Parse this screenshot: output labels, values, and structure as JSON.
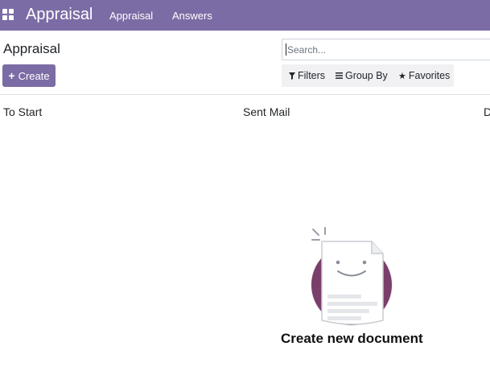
{
  "navbar": {
    "app_title": "Appraisal",
    "menu": [
      "Appraisal",
      "Answers"
    ]
  },
  "control_panel": {
    "breadcrumb": "Appraisal",
    "create_label": "Create",
    "search_placeholder": "Search...",
    "filters_label": "Filters",
    "group_by_label": "Group By",
    "favorites_label": "Favorites"
  },
  "kanban": {
    "columns": [
      "To Start",
      "Sent Mail",
      "D"
    ]
  },
  "empty_state": {
    "message": "Create new document"
  },
  "colors": {
    "brand": "#7c6ca5",
    "helper_circle": "#7a3e6a"
  }
}
